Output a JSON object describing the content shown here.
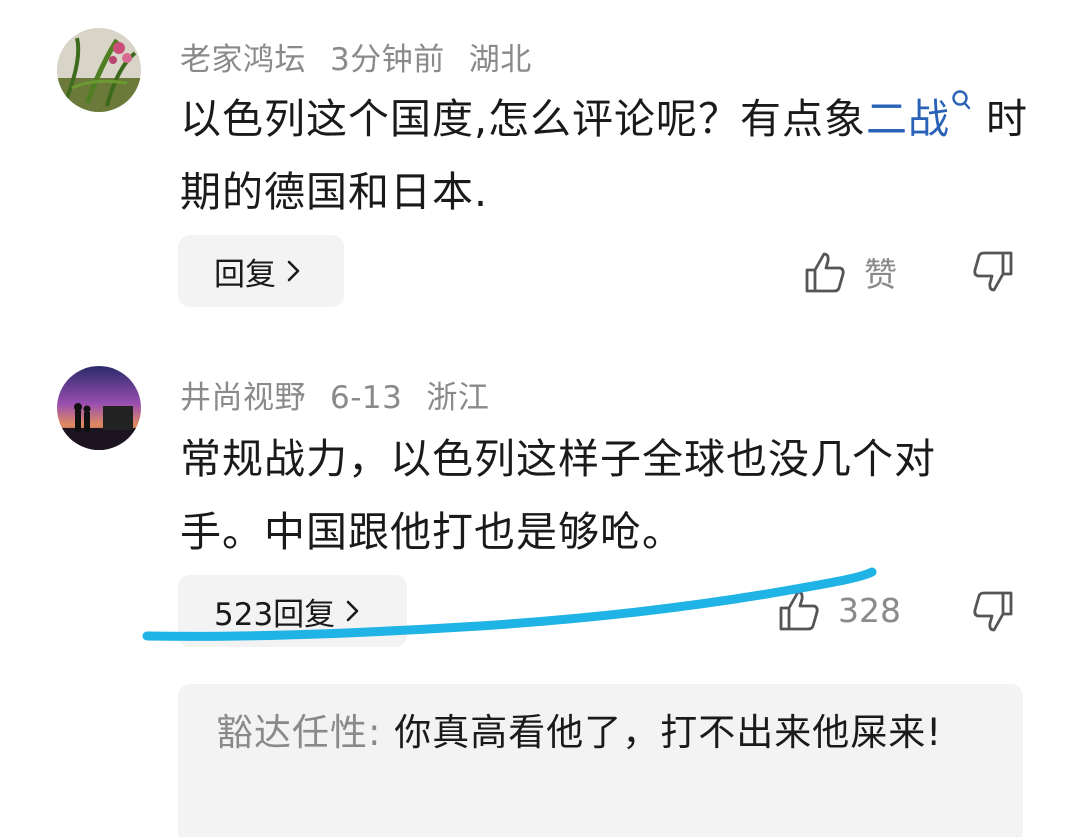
{
  "comments": [
    {
      "author": "老家鸿坛",
      "time": "3分钟前",
      "location": "湖北",
      "text_before": "以色列这个国度,怎么评论呢？有点象",
      "link_text": "二战",
      "text_after": "时期的德国和日本.",
      "reply_label": "回复",
      "like_label": "赞"
    },
    {
      "author": "井尚视野",
      "time": "6-13",
      "location": "浙江",
      "text": "常规战力，以色列这样子全球也没几个对手。中国跟他打也是够呛。",
      "reply_label": "523回复",
      "like_count": "328"
    }
  ],
  "sub_reply": {
    "author": "豁达任性:",
    "text": "你真高看他了，打不出来他屎来!"
  },
  "colors": {
    "link": "#2a62b8",
    "meta_gray": "#8a8a8a",
    "annotation": "#1fb3e6"
  },
  "icons": [
    "search-icon",
    "chevron-right-icon",
    "thumbs-up-icon",
    "thumbs-down-icon"
  ]
}
